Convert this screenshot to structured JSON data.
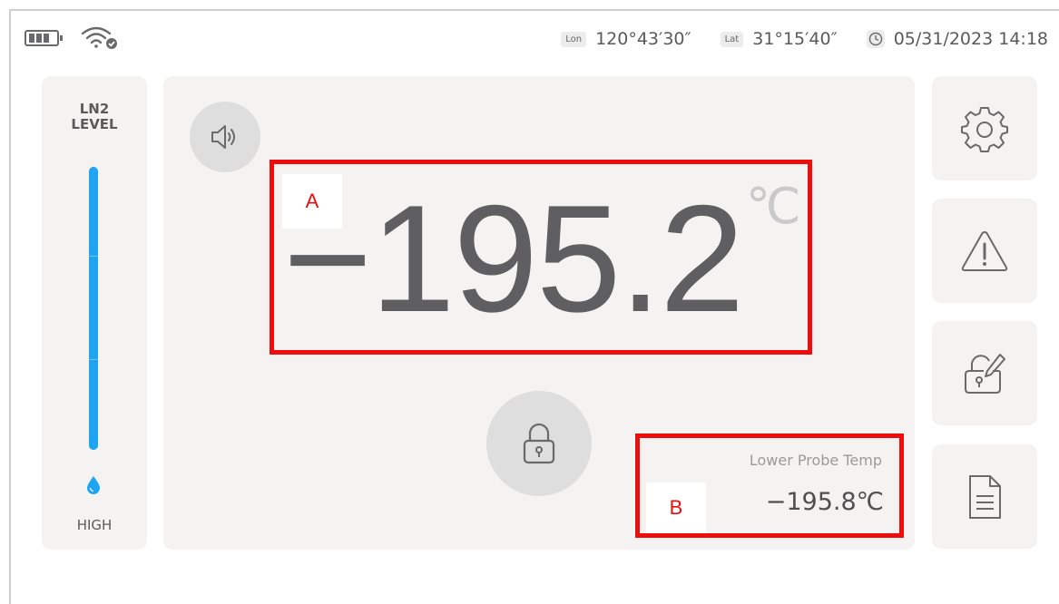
{
  "status_bar": {
    "battery_icon": "battery-icon",
    "wifi_icon": "wifi-icon",
    "lon_tag": "Lon",
    "lon_value": "120°43′30″",
    "lat_tag": "Lat",
    "lat_value": "31°15′40″",
    "clock_icon": "clock-icon",
    "datetime": "05/31/2023 14:18"
  },
  "ln2_panel": {
    "title_line1": "LN2",
    "title_line2": "LEVEL",
    "level_fraction": 1.0,
    "level_label": "HIGH",
    "accent_color": "#1ea4f3"
  },
  "main": {
    "marker_a": "A",
    "temperature": "−195.2",
    "unit": "℃",
    "marker_b": "B",
    "probe_label": "Lower Probe Temp",
    "probe_value": "−195.8℃",
    "highlight_color": "#ee0d0d"
  },
  "side_buttons": [
    "gear-icon",
    "warning-icon",
    "lock-edit-icon",
    "document-icon"
  ]
}
